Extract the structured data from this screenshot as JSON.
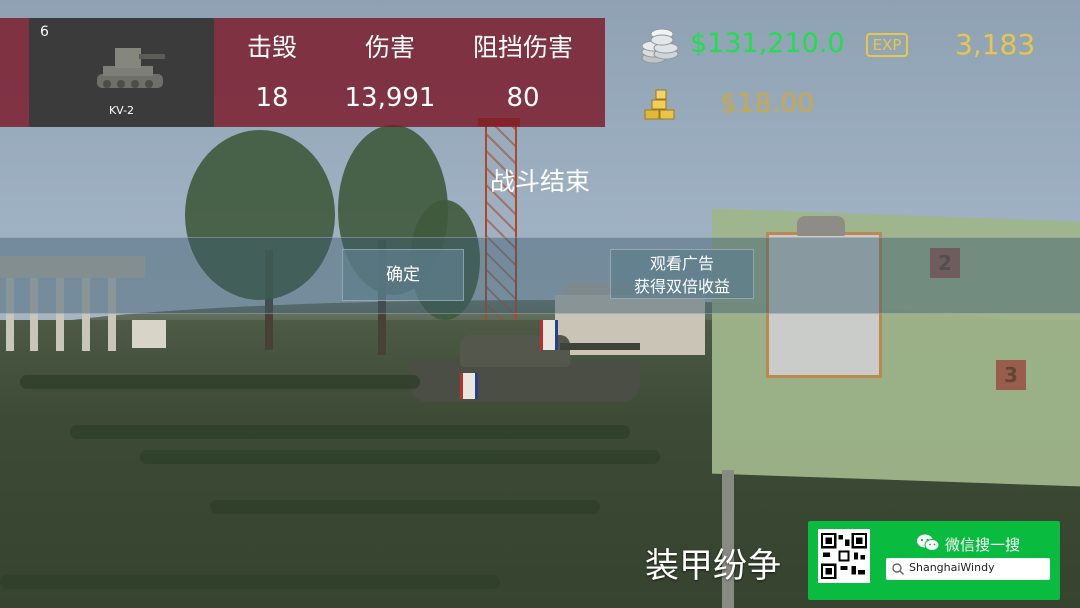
{
  "stats": {
    "tank": {
      "tier": "6",
      "name": "KV-2"
    },
    "columns": [
      {
        "label": "击毁",
        "value": "18"
      },
      {
        "label": "伤害",
        "value": "13,991"
      },
      {
        "label": "阻挡伤害",
        "value": "80"
      }
    ]
  },
  "currency": {
    "money": "$131,210.0",
    "exp_badge": "EXP",
    "exp_value": "3,183",
    "gold": "$18.00",
    "colors": {
      "money": "#1ee04a",
      "exp": "#e8c64a",
      "gold": "#c9a84a"
    },
    "icons": [
      "silver-coins-icon",
      "gold-bars-icon"
    ]
  },
  "battle": {
    "status": "战斗结束",
    "confirm_button": "确定",
    "ad_button_line1": "观看广告",
    "ad_button_line2": "获得双倍收益"
  },
  "branding": {
    "game_title": "装甲纷争",
    "wechat_label": "微信搜一搜",
    "search_value": "ShanghaiWindy",
    "accent": "#09bb3e"
  },
  "scene": {
    "map_numbers": [
      "2",
      "3"
    ]
  }
}
